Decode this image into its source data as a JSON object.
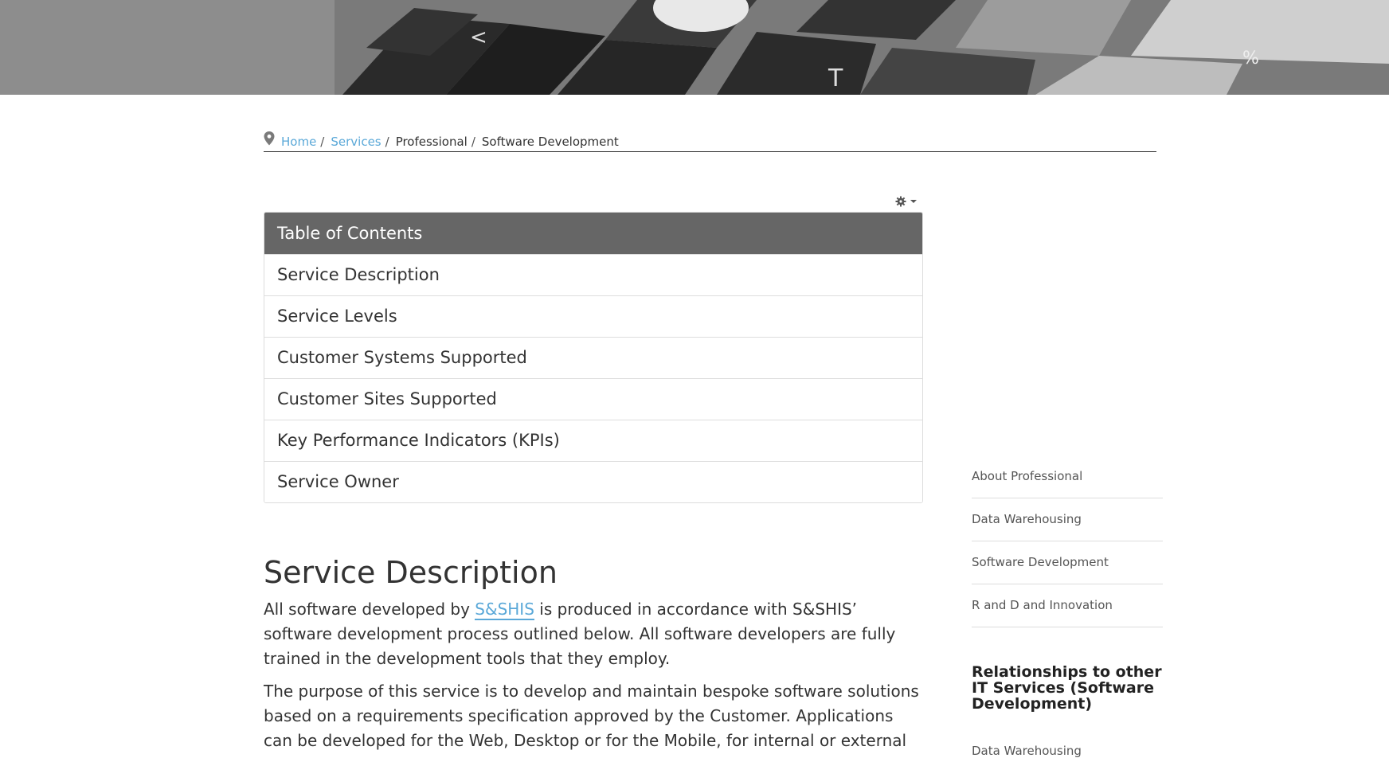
{
  "breadcrumb": {
    "home": "Home",
    "services": "Services",
    "professional": "Professional",
    "current": "Software Development",
    "separator": "/"
  },
  "toc": {
    "title": "Table of Contents",
    "items": [
      "Service Description",
      "Service Levels",
      "Customer Systems Supported",
      "Customer Sites Supported",
      "Key Performance Indicators (KPIs)",
      "Service Owner"
    ]
  },
  "content": {
    "section_title": "Service Description",
    "para1_before": "All software developed by ",
    "para1_link": "S&SHIS",
    "para1_after": " is produced in accordance with S&SHIS’ software development process outlined below. All software developers are fully trained in the development tools that they employ.",
    "para2": "The purpose of this service is to develop and maintain bespoke software solutions based on a requirements specification approved by the Customer. Applications can be developed for the Web, Desktop or for the Mobile, for internal or external usage. These"
  },
  "sidebar": {
    "items": [
      "About Professional",
      "Data Warehousing",
      "Software Development",
      "R and D and Innovation"
    ],
    "heading": "Relationships to other IT Services (Software Development)",
    "related_first": "Data Warehousing"
  },
  "icons": {
    "breadcrumb": "map-pin-icon",
    "settings": "gear-icon",
    "dropdown": "caret-down-icon"
  },
  "colors": {
    "link": "#5aa8d8",
    "toc_header_bg": "#666666"
  }
}
